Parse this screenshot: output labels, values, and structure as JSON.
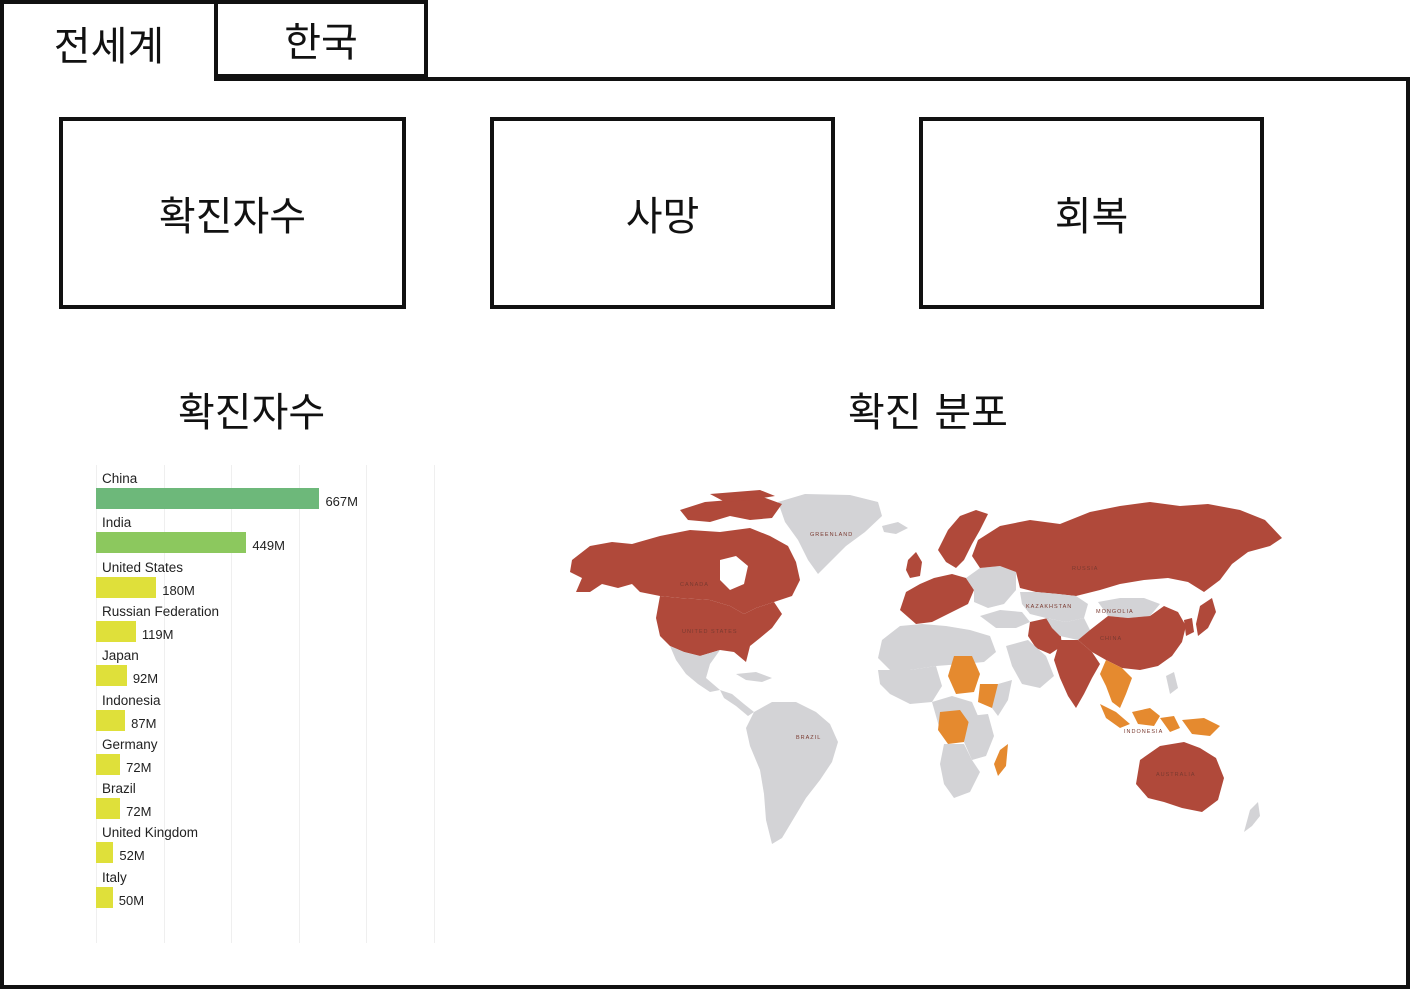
{
  "tabs": [
    {
      "label": "전세계",
      "active": true
    },
    {
      "label": "한국",
      "active": false
    }
  ],
  "cards": {
    "confirmed": "확진자수",
    "deaths": "사망",
    "recovered": "회복"
  },
  "sections": {
    "chart_title": "확진자수",
    "map_title": "확진 분포"
  },
  "colors": {
    "high": "#b0493a",
    "medium": "#e58a2f",
    "none": "#d3d3d6",
    "bar_top": "#6db87a",
    "bar_second": "#8cc85e",
    "bar_rest": "#dfe03a"
  },
  "chart_data": {
    "type": "bar",
    "orientation": "horizontal",
    "title": "",
    "categories": [
      "China",
      "India",
      "United States",
      "Russian Federation",
      "Japan",
      "Indonesia",
      "Germany",
      "Brazil",
      "United Kingdom",
      "Italy"
    ],
    "values": [
      667,
      449,
      180,
      119,
      92,
      87,
      72,
      72,
      52,
      50
    ],
    "value_labels": [
      "667M",
      "449M",
      "180M",
      "119M",
      "92M",
      "87M",
      "72M",
      "72M",
      "52M",
      "50M"
    ],
    "xlim": [
      0,
      1000
    ],
    "grid": true
  },
  "map": {
    "labels": {
      "greenland": "GREENLAND",
      "canada": "CANADA",
      "usa": "UNITED STATES",
      "russia": "RUSSIA",
      "kazakhstan": "KAZAKHSTAN",
      "mongolia": "MONGOLIA",
      "china": "CHINA",
      "brazil": "BRAZIL",
      "australia": "AUSTRALIA",
      "indonesia": "INDONESIA"
    }
  }
}
